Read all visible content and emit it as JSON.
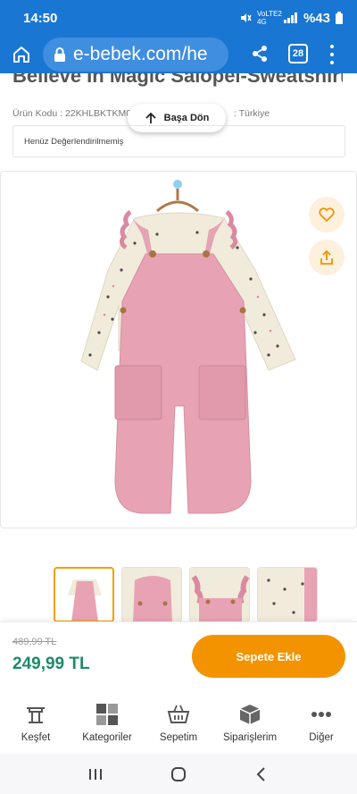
{
  "status_bar": {
    "time": "14:50",
    "network": "VoLTE2 4G",
    "battery": "%43"
  },
  "browser": {
    "url": "e-bebek.com/he",
    "tab_count": "28"
  },
  "product": {
    "title": "Believe In Magic Salopel-Sweatshirt",
    "code_label": "Ürün Kodu : 22KHLBKTKM07",
    "origin": ": Türkiye",
    "review_text": "Henüz Değerlendirilmemiş"
  },
  "back_to_top": {
    "label": "Başa Dön"
  },
  "price": {
    "old": "489,99 TL",
    "current": "249,99 TL"
  },
  "add_to_cart": {
    "label": "Sepete Ekle"
  },
  "bottom_nav": [
    {
      "label": "Keşfet",
      "icon": "discover-icon"
    },
    {
      "label": "Kategoriler",
      "icon": "categories-icon"
    },
    {
      "label": "Sepetim",
      "icon": "basket-icon"
    },
    {
      "label": "Siparişlerim",
      "icon": "orders-box-icon"
    },
    {
      "label": "Diğer",
      "icon": "more-icon"
    }
  ],
  "colors": {
    "header": "#1976d2",
    "cart_button": "#f39300",
    "price": "#1f8a6a",
    "overall_pink": "#e7a3b3"
  }
}
